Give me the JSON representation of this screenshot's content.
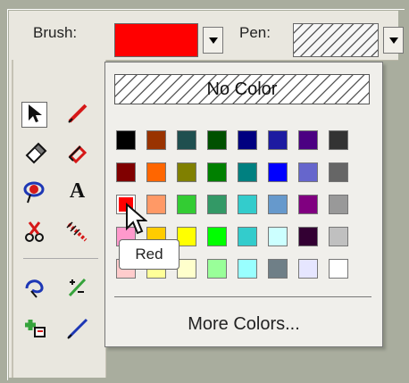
{
  "toolbar": {
    "brush_label": "Brush:",
    "pen_label": "Pen:",
    "brush_color": "#ff0000",
    "pen_pattern": "no-color-hatch"
  },
  "tools": [
    {
      "name": "select-arrow-icon"
    },
    {
      "name": "line-tool-icon"
    },
    {
      "name": "eraser-icon"
    },
    {
      "name": "rectangle-outline-icon"
    },
    {
      "name": "lasso-select-icon"
    },
    {
      "name": "text-tool-icon"
    },
    {
      "name": "scissors-icon"
    },
    {
      "name": "dashed-line-icon"
    },
    {
      "name": "freeform-shape-icon"
    },
    {
      "name": "connector-icon"
    },
    {
      "name": "add-point-icon"
    },
    {
      "name": "diagonal-line-icon"
    }
  ],
  "popup": {
    "no_color_label": "No Color",
    "more_colors_label": "More Colors...",
    "tooltip": "Red",
    "colors": [
      "#000000",
      "#993300",
      "#1f4f4f",
      "#005000",
      "#000080",
      "#1d1ba1",
      "#4b0082",
      "#333333",
      "#800000",
      "#ff6600",
      "#808000",
      "#008000",
      "#008080",
      "#0000ff",
      "#6666cc",
      "#666666",
      "#ff0000",
      "#ff9966",
      "#33cc33",
      "#339966",
      "#33cccc",
      "#6699cc",
      "#800080",
      "#999999",
      "#ff99cc",
      "#ffcc00",
      "#ffff00",
      "#00ff00",
      "#33cccc",
      "#ccffff",
      "#330033",
      "#c0c0c0",
      "#ffcccc",
      "#ffff99",
      "#ffffcc",
      "#99ff99",
      "#99ffff",
      "#6f7f87",
      "#e6e6ff",
      "#ffffff"
    ],
    "selected_color": "#ff0000"
  }
}
